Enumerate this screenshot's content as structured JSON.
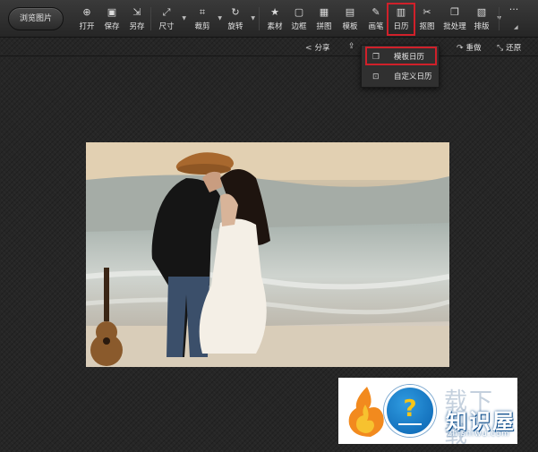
{
  "toolbar": {
    "browse_label": "浏览图片",
    "tools": [
      {
        "label": "打开",
        "icon": "open-icon",
        "glyph": "⊕"
      },
      {
        "label": "保存",
        "icon": "save-icon",
        "glyph": "▣"
      },
      {
        "label": "另存",
        "icon": "save-as-icon",
        "glyph": "⇲"
      },
      {
        "label": "尺寸",
        "icon": "resize-icon",
        "glyph": "⤢"
      },
      {
        "label": "裁剪",
        "icon": "crop-icon",
        "glyph": "⌗"
      },
      {
        "label": "旋转",
        "icon": "rotate-icon",
        "glyph": "↻"
      },
      {
        "label": "素材",
        "icon": "material-icon",
        "glyph": "★"
      },
      {
        "label": "边框",
        "icon": "border-icon",
        "glyph": "▢"
      },
      {
        "label": "拼图",
        "icon": "collage-icon",
        "glyph": "▦"
      },
      {
        "label": "模板",
        "icon": "template-icon",
        "glyph": "▤"
      },
      {
        "label": "画笔",
        "icon": "brush-icon",
        "glyph": "✎"
      },
      {
        "label": "日历",
        "icon": "calendar-icon",
        "glyph": "▥"
      },
      {
        "label": "抠图",
        "icon": "cutout-icon",
        "glyph": "✂"
      },
      {
        "label": "批处理",
        "icon": "batch-icon",
        "glyph": "❐"
      },
      {
        "label": "排版",
        "icon": "layout-icon",
        "glyph": "▧"
      }
    ],
    "more_label": "···"
  },
  "secondbar": {
    "share": "分享",
    "redo": "重做",
    "restore": "还原"
  },
  "calendar_menu": {
    "items": [
      {
        "label": "模板日历",
        "icon": "template-calendar-icon"
      },
      {
        "label": "自定义日历",
        "icon": "custom-calendar-icon"
      }
    ]
  },
  "watermark": {
    "ghost": "载下载",
    "brand": "知识屋",
    "url": "zhishiwu.com"
  },
  "colors": {
    "highlight": "#d0202a",
    "toolbar_bg": "#2e2e2e",
    "canvas_bg": "#262626"
  }
}
